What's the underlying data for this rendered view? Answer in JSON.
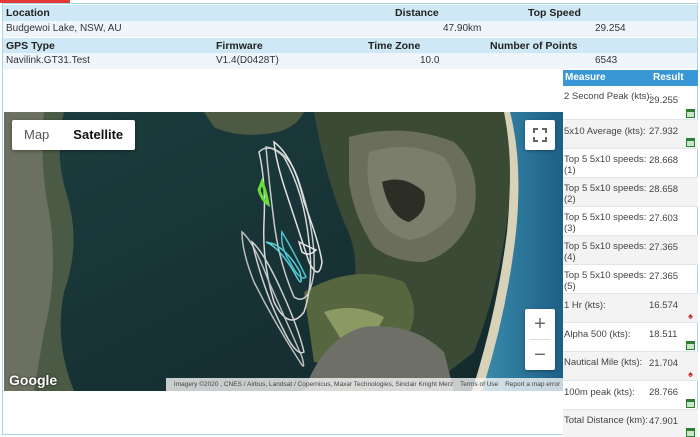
{
  "summary": {
    "headers1": {
      "location": "Location",
      "distance": "Distance",
      "top_speed": "Top Speed"
    },
    "values1": {
      "location": "Budgewoi Lake, NSW, AU",
      "distance": "47.90km",
      "top_speed": "29.254"
    },
    "headers2": {
      "gps_type": "GPS Type",
      "firmware": "Firmware",
      "time_zone": "Time Zone",
      "points": "Number of Points"
    },
    "values2": {
      "gps_type": "Navilink.GT31.Test",
      "firmware": "V1.4(D0428T)",
      "time_zone": "10.0",
      "points": "6543"
    }
  },
  "map": {
    "toggle": {
      "map": "Map",
      "satellite": "Satellite"
    },
    "zoom_in": "+",
    "zoom_out": "−",
    "logo": "Google",
    "attribution": "Imagery ©2020 , CNES / Airbus, Landsat / Copernicus, Maxar Technologies, Sinclair Knight Merz",
    "terms": "Terms of Use",
    "report": "Report a map error"
  },
  "results": {
    "headers": {
      "measure": "Measure",
      "result": "Result"
    },
    "rows": [
      {
        "label": "2 Second Peak (kts):",
        "value": "29.255",
        "icon": "calendar-icon"
      },
      {
        "label": "5x10 Average (kts):",
        "value": "27.932",
        "icon": "calendar-icon"
      },
      {
        "label": "Top 5 5x10 speeds: (1)",
        "value": "28.668",
        "icon": ""
      },
      {
        "label": "Top 5 5x10 speeds: (2)",
        "value": "28.658",
        "icon": ""
      },
      {
        "label": "Top 5 5x10 speeds: (3)",
        "value": "27.603",
        "icon": ""
      },
      {
        "label": "Top 5 5x10 speeds: (4)",
        "value": "27.365",
        "icon": ""
      },
      {
        "label": "Top 5 5x10 speeds: (5)",
        "value": "27.365",
        "icon": ""
      },
      {
        "label": "1 Hr (kts):",
        "value": "16.574",
        "icon": "trophy-icon"
      },
      {
        "label": "Alpha 500 (kts):",
        "value": "18.511",
        "icon": "calendar-icon"
      },
      {
        "label": "Nautical Mile (kts):",
        "value": "21.704",
        "icon": "trophy-icon"
      },
      {
        "label": "100m peak (kts):",
        "value": "28.766",
        "icon": "calendar-icon"
      },
      {
        "label": "Total Distance (km):",
        "value": "47.901",
        "icon": "calendar-icon"
      }
    ]
  },
  "colors": {
    "header_bg": "#cfe8f5",
    "row_bg": "#eef6fb",
    "results_header": "#3a97d6",
    "accent_red": "#e53935"
  }
}
